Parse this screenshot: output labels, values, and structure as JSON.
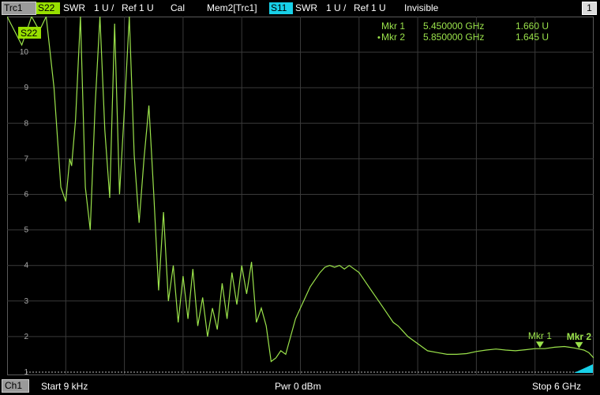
{
  "header": {
    "trace_label": "Trc1",
    "param_badge": "S22",
    "format": "SWR",
    "scale": "1 U /",
    "ref": "Ref 1 U",
    "cal": "Cal",
    "mem_label": "Mem2[Trc1]",
    "mem_param_badge": "S11",
    "mem_format": "SWR",
    "mem_scale": "1 U /",
    "mem_ref": "Ref 1 U",
    "mem_state": "Invisible",
    "window_number": "1"
  },
  "footer": {
    "channel": "Ch1",
    "start": "Start  9 kHz",
    "power": "Pwr  0 dBm",
    "stop": "Stop  6 GHz"
  },
  "colors": {
    "trace": "#9be34b",
    "s22_badge": "#98e000",
    "s11_badge": "#18d0e8",
    "grid": "#3a3a3a",
    "background": "#000000",
    "marker_text": "#9be34b"
  },
  "chart_data": {
    "type": "line",
    "title": "",
    "xlabel": "",
    "ylabel": "",
    "trace_badge": "S22",
    "x_unit": "GHz",
    "xlim": [
      9e-06,
      6.0
    ],
    "ylim": [
      1,
      11
    ],
    "y_ticks": [
      "1",
      "2",
      "3",
      "4",
      "5",
      "6",
      "7",
      "8",
      "9",
      "10"
    ],
    "grid": true,
    "reference_line_value": 1,
    "series": [
      {
        "x": [
          0.0,
          0.15,
          0.25,
          0.33,
          0.4,
          0.48,
          0.55,
          0.6,
          0.64,
          0.66,
          0.7,
          0.75,
          0.8,
          0.85,
          0.9,
          0.95,
          1.0,
          1.05,
          1.1,
          1.15,
          1.2,
          1.25,
          1.3,
          1.35,
          1.4,
          1.45,
          1.5,
          1.55,
          1.6,
          1.65,
          1.7,
          1.75,
          1.8,
          1.85,
          1.9,
          1.95,
          2.0,
          2.05,
          2.1,
          2.15,
          2.2,
          2.25,
          2.3,
          2.35,
          2.4,
          2.45,
          2.5,
          2.55,
          2.6,
          2.65,
          2.7,
          2.75,
          2.8,
          2.85,
          2.9,
          2.95,
          3.0,
          3.05,
          3.1,
          3.15,
          3.2,
          3.25,
          3.3,
          3.35,
          3.4,
          3.45,
          3.5,
          3.55,
          3.6,
          3.65,
          3.7,
          3.75,
          3.8,
          3.85,
          3.9,
          3.95,
          4.0,
          4.1,
          4.2,
          4.3,
          4.4,
          4.5,
          4.6,
          4.7,
          4.8,
          4.9,
          5.0,
          5.1,
          5.2,
          5.3,
          5.4,
          5.45,
          5.5,
          5.6,
          5.7,
          5.75,
          5.8,
          5.85,
          5.9,
          5.95,
          6.0
        ],
        "y": [
          11.0,
          10.2,
          11.0,
          10.6,
          11.0,
          9.0,
          6.2,
          5.8,
          7.0,
          6.8,
          8.1,
          11.0,
          6.2,
          5.0,
          8.5,
          11.0,
          7.8,
          5.9,
          10.8,
          6.0,
          8.4,
          11.0,
          7.1,
          5.2,
          7.0,
          8.5,
          6.0,
          3.3,
          5.5,
          3.0,
          4.0,
          2.4,
          3.7,
          2.5,
          3.9,
          2.3,
          3.1,
          2.0,
          2.8,
          2.2,
          3.5,
          2.5,
          3.8,
          2.9,
          4.0,
          3.2,
          4.1,
          2.4,
          2.8,
          2.3,
          1.3,
          1.4,
          1.6,
          1.5,
          2.0,
          2.5,
          2.8,
          3.1,
          3.4,
          3.6,
          3.8,
          3.95,
          4.0,
          3.95,
          4.0,
          3.9,
          4.0,
          3.9,
          3.8,
          3.6,
          3.4,
          3.2,
          3.0,
          2.8,
          2.6,
          2.4,
          2.3,
          2.0,
          1.8,
          1.6,
          1.55,
          1.5,
          1.5,
          1.52,
          1.58,
          1.62,
          1.65,
          1.62,
          1.6,
          1.63,
          1.66,
          1.66,
          1.66,
          1.7,
          1.72,
          1.7,
          1.68,
          1.65,
          1.62,
          1.55,
          1.4
        ]
      }
    ],
    "markers": [
      {
        "label": "Mkr 1",
        "freq_text": "5.450000 GHz",
        "value_text": "1.660 U",
        "x": 5.45,
        "y": 1.66,
        "active": false
      },
      {
        "label": "Mkr 2",
        "freq_text": "5.850000 GHz",
        "value_text": "1.645 U",
        "x": 5.85,
        "y": 1.645,
        "active": true
      }
    ],
    "marker_table": [
      {
        "name": "Mkr 1",
        "freq": "5.450000 GHz",
        "value": "1.660 U"
      },
      {
        "name": "Mkr 2",
        "freq": "5.850000 GHz",
        "value": "1.645 U",
        "prefix": "•"
      }
    ]
  }
}
